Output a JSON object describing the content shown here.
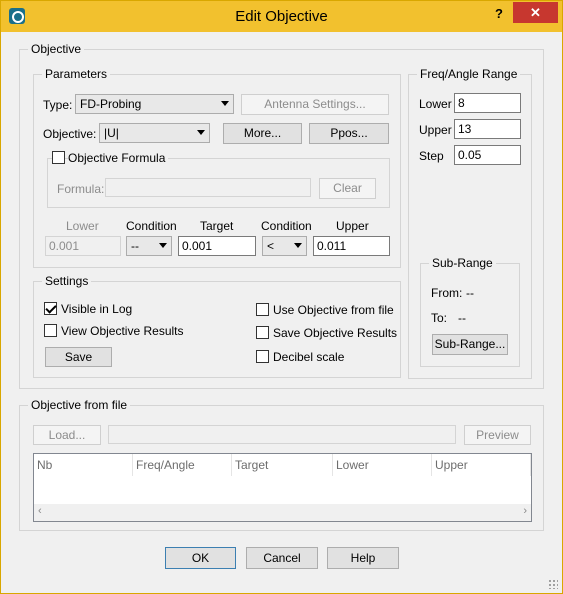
{
  "window": {
    "title": "Edit Objective",
    "help_label": "?",
    "close_label": "✕"
  },
  "objective_group": {
    "label": "Objective",
    "parameters": {
      "label": "Parameters",
      "type_label": "Type:",
      "type_value": "FD-Probing",
      "antenna_button": "Antenna Settings...",
      "objective_label": "Objective:",
      "objective_value": "|U|",
      "more_button": "More...",
      "ppos_button": "Ppos...",
      "formula_checkbox": "Objective Formula",
      "formula_label": "Formula:",
      "formula_value": "",
      "clear_button": "Clear",
      "headers": {
        "lower": "Lower",
        "condition1": "Condition",
        "target": "Target",
        "condition2": "Condition",
        "upper": "Upper"
      },
      "lower_value": "0.001",
      "condition1_value": "--",
      "target_value": "0.001",
      "condition2_value": "<",
      "upper_value": "0.011"
    },
    "freq_range": {
      "label": "Freq/Angle Range",
      "lower_label": "Lower",
      "lower_value": "8",
      "upper_label": "Upper",
      "upper_value": "13",
      "step_label": "Step",
      "step_value": "0.05"
    },
    "sub_range": {
      "label": "Sub-Range",
      "from_label": "From:",
      "from_value": "--",
      "to_label": "To:",
      "to_value": "--",
      "button": "Sub-Range..."
    },
    "settings": {
      "label": "Settings",
      "visible_in_log": "Visible in Log",
      "view_results": "View Objective Results",
      "save_button": "Save",
      "use_from_file": "Use Objective from file",
      "save_results": "Save Objective Results",
      "decibel_scale": "Decibel scale"
    }
  },
  "file_group": {
    "label": "Objective from file",
    "load_button": "Load...",
    "path_value": "",
    "preview_button": "Preview",
    "columns": [
      "Nb",
      "Freq/Angle",
      "Target",
      "Lower",
      "Upper"
    ]
  },
  "footer": {
    "ok": "OK",
    "cancel": "Cancel",
    "help": "Help"
  }
}
